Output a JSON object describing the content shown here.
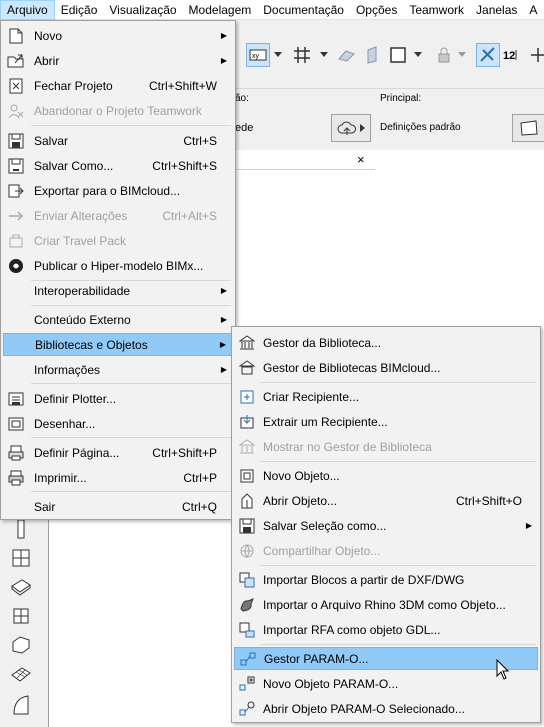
{
  "menubar": [
    {
      "label": "Arquivo",
      "active": true
    },
    {
      "label": "Edição"
    },
    {
      "label": "Visualização"
    },
    {
      "label": "Modelagem"
    },
    {
      "label": "Documentação"
    },
    {
      "label": "Opções"
    },
    {
      "label": "Teamwork"
    },
    {
      "label": "Janelas"
    },
    {
      "label": "A"
    }
  ],
  "info": {
    "label_left": "ão:",
    "label_right": "Principal:",
    "value_left": "ede",
    "value_right": "Definições padrão"
  },
  "tab_close": "×",
  "file_menu": [
    {
      "label": "Novo",
      "arrow": "▶",
      "icon": "new-file-icon"
    },
    {
      "label": "Abrir",
      "arrow": "▶",
      "icon": "open-folder-icon"
    },
    {
      "label": "Fechar Projeto",
      "shortcut": "Ctrl+Shift+W",
      "icon": "close-project-icon"
    },
    {
      "label": "Abandonar o Projeto Teamwork",
      "disabled": true,
      "icon": "abandon-teamwork-icon"
    },
    {
      "label": "Salvar",
      "shortcut": "Ctrl+S",
      "icon": "save-icon"
    },
    {
      "label": "Salvar Como...",
      "shortcut": "Ctrl+Shift+S",
      "icon": "save-as-icon"
    },
    {
      "label": "Exportar para o BIMcloud...",
      "icon": "export-bimcloud-icon"
    },
    {
      "label": "Enviar Alterações",
      "shortcut": "Ctrl+Alt+S",
      "disabled": true,
      "icon": "send-changes-icon"
    },
    {
      "label": "Criar Travel Pack",
      "disabled": true,
      "icon": "travel-pack-icon"
    },
    {
      "label": "Publicar o Hiper-modelo BIMx...",
      "icon": "bimx-icon"
    },
    {
      "label": "Interoperabilidade",
      "arrow": "▶"
    },
    {
      "label": "Conteúdo Externo",
      "arrow": "▶"
    },
    {
      "label": "Bibliotecas e Objetos",
      "arrow": "▶",
      "highlighted": true
    },
    {
      "label": "Informações",
      "arrow": "▶"
    },
    {
      "label": "Definir Plotter...",
      "icon": "plotter-setup-icon"
    },
    {
      "label": "Desenhar...",
      "icon": "plot-icon"
    },
    {
      "label": "Definir Página...",
      "shortcut": "Ctrl+Shift+P",
      "icon": "page-setup-icon"
    },
    {
      "label": "Imprimir...",
      "shortcut": "Ctrl+P",
      "icon": "print-icon"
    },
    {
      "label": "Sair",
      "shortcut": "Ctrl+Q"
    }
  ],
  "sub_menu": [
    {
      "label": "Gestor da Biblioteca...",
      "icon": "library-manager-icon"
    },
    {
      "label": "Gestor de Bibliotecas BIMcloud...",
      "icon": "bimcloud-library-icon"
    },
    {
      "label": "Criar Recipiente...",
      "icon": "create-container-icon"
    },
    {
      "label": "Extrair um Recipiente...",
      "icon": "extract-container-icon"
    },
    {
      "label": "Mostrar no Gestor de Biblioteca",
      "disabled": true,
      "icon": "show-in-library-icon"
    },
    {
      "label": "Novo Objeto...",
      "icon": "new-object-icon"
    },
    {
      "label": "Abrir Objeto...",
      "shortcut": "Ctrl+Shift+O",
      "icon": "open-object-icon"
    },
    {
      "label": "Salvar Seleção como...",
      "arrow": "▶",
      "icon": "save-selection-icon"
    },
    {
      "label": "Compartilhar Objeto...",
      "disabled": true,
      "icon": "share-object-icon"
    },
    {
      "label": "Importar Blocos a partir de DXF/DWG",
      "icon": "import-dxf-icon"
    },
    {
      "label": "Importar o Arquivo Rhino 3DM como Objeto...",
      "icon": "import-rhino-icon"
    },
    {
      "label": "Importar RFA como objeto GDL...",
      "icon": "import-rfa-icon"
    },
    {
      "label": "Gestor PARAM-O...",
      "highlighted": true,
      "icon": "param-o-manager-icon"
    },
    {
      "label": "Novo Objeto PARAM-O...",
      "icon": "new-param-o-icon"
    },
    {
      "label": "Abrir Objeto PARAM-O Selecionado...",
      "icon": "open-param-o-icon"
    }
  ]
}
